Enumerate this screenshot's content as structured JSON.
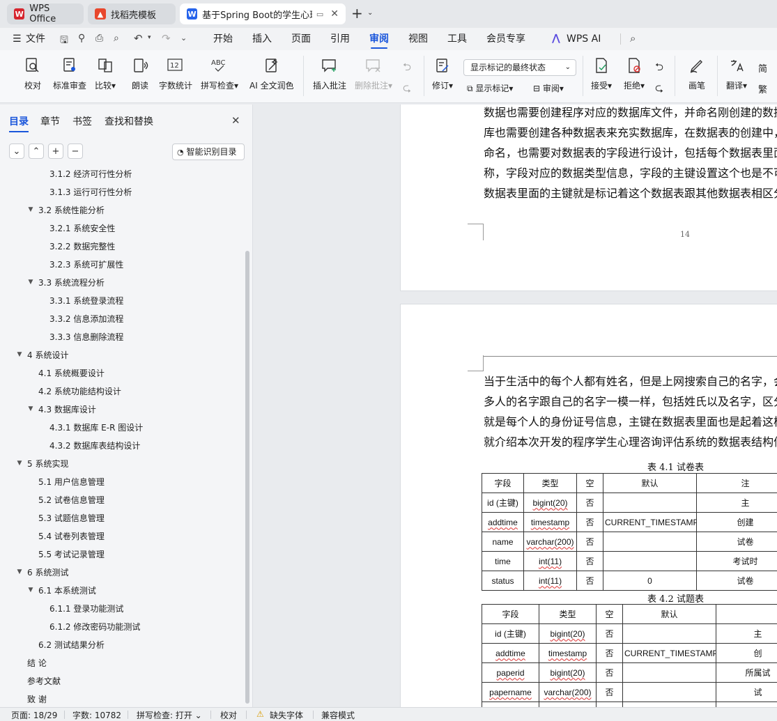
{
  "tabs": [
    {
      "label": "WPS Office",
      "icon": "wps-logo-icon",
      "color": "#d6252e"
    },
    {
      "label": "找稻壳模板",
      "icon": "docer-logo-icon",
      "color": "#e8472c"
    },
    {
      "label": "基于Spring Boot的学生心理",
      "icon": "word-doc-icon",
      "color": "#2563eb"
    }
  ],
  "menus": [
    "文件",
    "开始",
    "插入",
    "页面",
    "引用",
    "审阅",
    "视图",
    "工具",
    "会员专享",
    "WPS AI"
  ],
  "active_menu": "审阅",
  "ribbon": {
    "buttons": [
      {
        "label": "校对",
        "icon": "proofread-icon"
      },
      {
        "label": "标准审查",
        "icon": "standard-review-icon"
      },
      {
        "label": "比较",
        "icon": "compare-icon",
        "dropdown": true
      },
      {
        "label": "朗读",
        "icon": "read-aloud-icon"
      },
      {
        "label": "字数统计",
        "icon": "word-count-icon"
      },
      {
        "label": "拼写检查",
        "icon": "spell-check-icon",
        "dropdown": true
      },
      {
        "label": "AI 全文润色",
        "icon": "ai-polish-icon"
      },
      {
        "label": "插入批注",
        "icon": "insert-comment-icon"
      },
      {
        "label": "删除批注",
        "icon": "delete-comment-icon",
        "dropdown": true,
        "disabled": true
      },
      {
        "label": "修订",
        "icon": "track-changes-icon",
        "dropdown": true
      },
      {
        "label": "显示标记",
        "icon": "show-markup-icon",
        "dropdown": true
      },
      {
        "label": "审阅",
        "icon": "review-pane-icon",
        "dropdown": true
      },
      {
        "label": "接受",
        "icon": "accept-icon",
        "dropdown": true
      },
      {
        "label": "拒绝",
        "icon": "reject-icon",
        "dropdown": true
      },
      {
        "label": "画笔",
        "icon": "pen-icon"
      },
      {
        "label": "翻译",
        "icon": "translate-icon",
        "dropdown": true
      }
    ],
    "markup_select": "显示标记的最终状态",
    "tc_labels": [
      "简",
      "繁"
    ]
  },
  "sidebar": {
    "tabs": [
      "目录",
      "章节",
      "书签",
      "查找和替换"
    ],
    "active_tab": "目录",
    "smart_toc": "智能识别目录",
    "toc": [
      {
        "label": "3.1.2 经济可行性分析",
        "level": 3
      },
      {
        "label": "3.1.3 运行可行性分析",
        "level": 3
      },
      {
        "label": "3.2 系统性能分析",
        "level": 2,
        "expanded": true
      },
      {
        "label": "3.2.1 系统安全性",
        "level": 3
      },
      {
        "label": "3.2.2 数据完整性",
        "level": 3
      },
      {
        "label": "3.2.3 系统可扩展性",
        "level": 3
      },
      {
        "label": "3.3 系统流程分析",
        "level": 2,
        "expanded": true
      },
      {
        "label": "3.3.1 系统登录流程",
        "level": 3
      },
      {
        "label": "3.3.2 信息添加流程",
        "level": 3
      },
      {
        "label": "3.3.3 信息删除流程",
        "level": 3
      },
      {
        "label": "4 系统设计",
        "level": 1,
        "expanded": true
      },
      {
        "label": "4.1 系统概要设计",
        "level": 2
      },
      {
        "label": "4.2 系统功能结构设计",
        "level": 2
      },
      {
        "label": "4.3 数据库设计",
        "level": 2,
        "expanded": true
      },
      {
        "label": "4.3.1 数据库 E-R 图设计",
        "level": 3
      },
      {
        "label": "4.3.2 数据库表结构设计",
        "level": 3
      },
      {
        "label": "5 系统实现",
        "level": 1,
        "expanded": true
      },
      {
        "label": "5.1 用户信息管理",
        "level": 2
      },
      {
        "label": "5.2 试卷信息管理",
        "level": 2
      },
      {
        "label": "5.3 试题信息管理",
        "level": 2
      },
      {
        "label": "5.4 试卷列表管理",
        "level": 2
      },
      {
        "label": "5.5 考试记录管理",
        "level": 2
      },
      {
        "label": "6 系统测试",
        "level": 1,
        "expanded": true
      },
      {
        "label": "6.1 本系统测试",
        "level": 2,
        "expanded": true
      },
      {
        "label": "6.1.1 登录功能测试",
        "level": 3
      },
      {
        "label": "6.1.2 修改密码功能测试",
        "level": 3
      },
      {
        "label": "6.2 测试结果分析",
        "level": 2
      },
      {
        "label": "结 论",
        "level": 1
      },
      {
        "label": "参考文献",
        "level": 1
      },
      {
        "label": "致 谢",
        "level": 1
      }
    ]
  },
  "document": {
    "page1_lines": [
      "数据也需要创建程序对应的数据库文件，并命名刚创建的数据",
      "库也需要创建各种数据表来充实数据库，在数据表的创建中，",
      "命名，也需要对数据表的字段进行设计，包括每个数据表里面",
      "称，字段对应的数据类型信息，字段的主键设置这个也是不可",
      "数据表里面的主键就是标记着这个数据表跟其他数据表相区分"
    ],
    "page_number": "14",
    "page2_lines": [
      "当于生活中的每个人都有姓名，但是上网搜索自己的名字，会",
      "多人的名字跟自己的名字一模一样，包括姓氏以及名字，区分",
      "就是每个人的身份证号信息，主键在数据表里面也是起着这样",
      "就介绍本次开发的程序学生心理咨询评估系统的数据表结构信"
    ],
    "table1": {
      "caption": "表 4.1  试卷表",
      "headers": [
        "字段",
        "类型",
        "空",
        "默认",
        "注"
      ],
      "rows": [
        [
          "id (主键)",
          "bigint(20)",
          "否",
          "",
          "主"
        ],
        [
          "addtime",
          "timestamp",
          "否",
          "CURRENT_TIMESTAMP",
          "创建"
        ],
        [
          "name",
          "varchar(200)",
          "否",
          "",
          "试卷"
        ],
        [
          "time",
          "int(11)",
          "否",
          "",
          "考试时"
        ],
        [
          "status",
          "int(11)",
          "否",
          "0",
          "试卷"
        ]
      ]
    },
    "table2": {
      "caption": "表 4.2  试题表",
      "headers": [
        "字段",
        "类型",
        "空",
        "默认",
        ""
      ],
      "rows": [
        [
          "id (主键)",
          "bigint(20)",
          "否",
          "",
          "主"
        ],
        [
          "addtime",
          "timestamp",
          "否",
          "CURRENT_TIMESTAMP",
          "创"
        ],
        [
          "paperid",
          "bigint(20)",
          "否",
          "",
          "所属试"
        ],
        [
          "papername",
          "varchar(200)",
          "否",
          "",
          "试"
        ],
        [
          "",
          "",
          "否",
          "",
          ""
        ]
      ]
    }
  },
  "status": {
    "page": "页面: 18/29",
    "words": "字数: 10782",
    "spell": "拼写检查: 打开",
    "proof": "校对",
    "missing_font": "缺失字体",
    "compat": "兼容模式"
  }
}
